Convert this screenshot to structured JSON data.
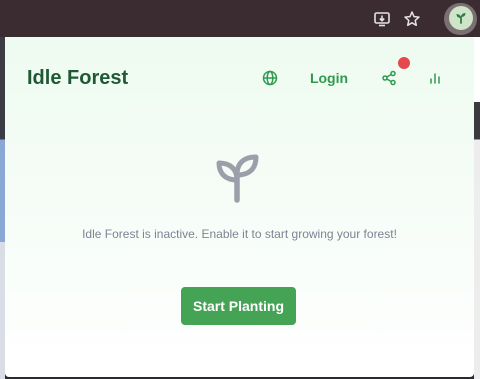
{
  "browser": {
    "icons": [
      "install-app-icon",
      "bookmark-star-icon",
      "extension-sprout-icon"
    ]
  },
  "popup": {
    "title": "Idle Forest",
    "login_label": "Login",
    "message": "Idle Forest is inactive. Enable it to start growing your forest!",
    "start_button_label": "Start Planting",
    "icons": [
      "globe-icon",
      "share-icon",
      "bar-chart-icon",
      "sprout-icon"
    ],
    "colors": {
      "accent": "#45a356",
      "title": "#1f5a35",
      "notification": "#e5484d",
      "message_text": "#7b8494",
      "sprout": "#9aa0aa"
    }
  }
}
